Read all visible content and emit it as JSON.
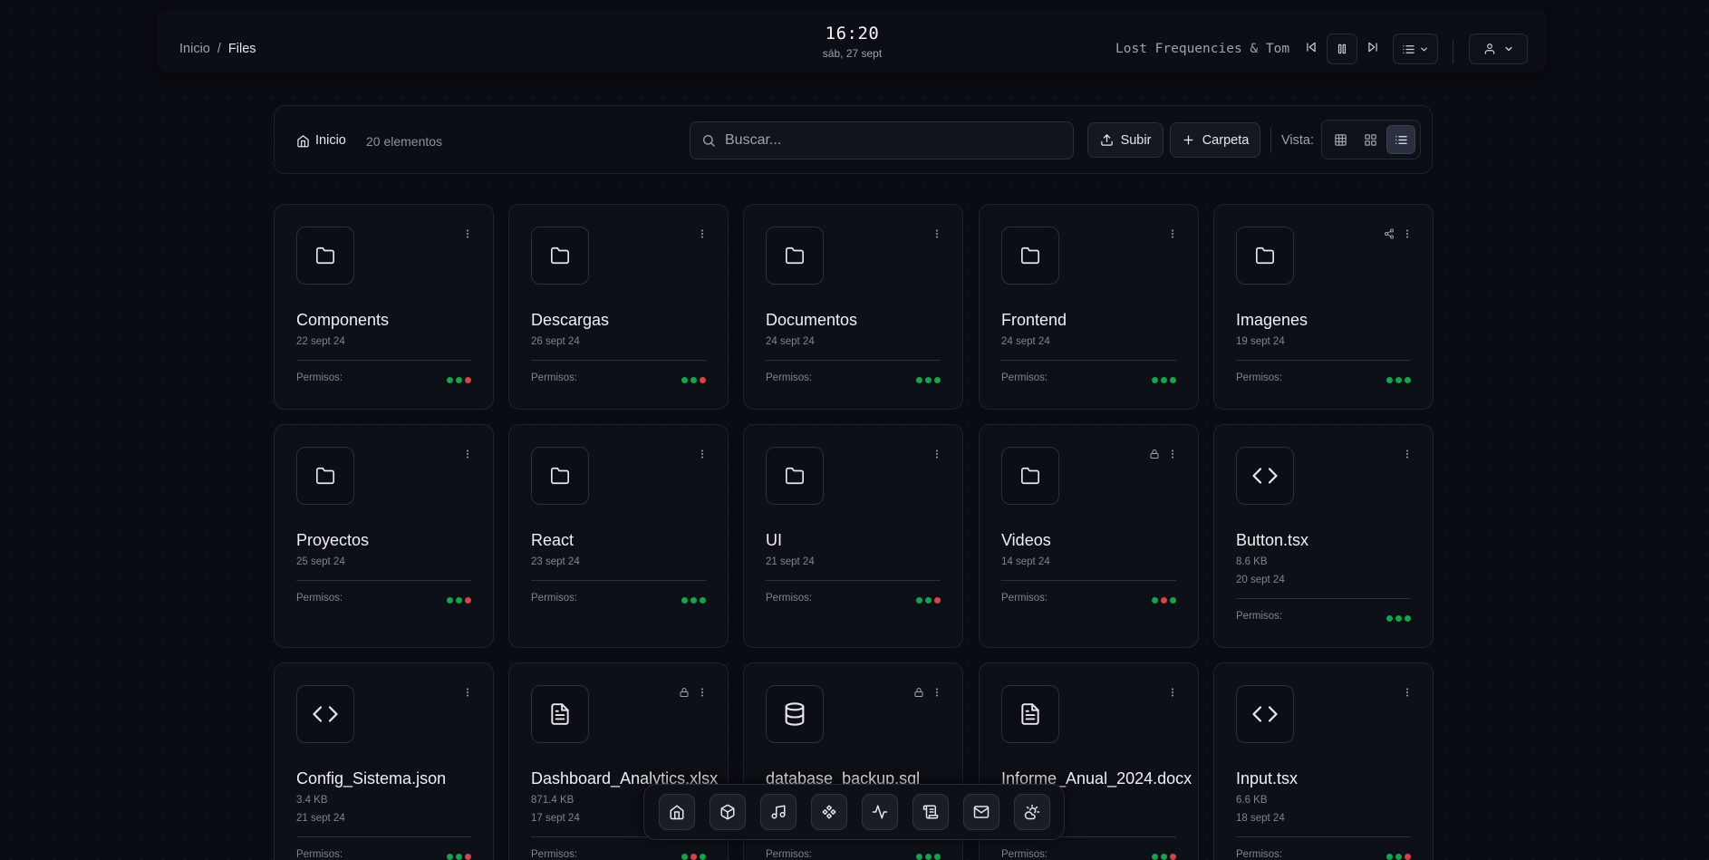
{
  "topbar": {
    "breadcrumb": {
      "root": "Inicio",
      "separator": "/",
      "current": "Files"
    },
    "clock": {
      "time": "16:20",
      "date": "sáb, 27 sept"
    },
    "now_playing": "Lost Frequencies & Tom",
    "player_icons": [
      "skip-back-icon",
      "pause-icon",
      "skip-forward-icon",
      "playlist-icon"
    ],
    "user_icon": "user-icon"
  },
  "toolbar": {
    "home_label": "Inicio",
    "item_count": "20 elementos",
    "search_placeholder": "Buscar...",
    "upload_label": "Subir",
    "folder_label": "Carpeta",
    "view_label": "Vista:",
    "view_modes": [
      "grid-large",
      "grid-small",
      "list"
    ],
    "active_view": "list"
  },
  "permissions_label": "Permisos:",
  "colors": {
    "granted": "#16a34a",
    "denied": "#d64545",
    "background": "#090c12"
  },
  "cards": [
    {
      "name": "Components",
      "type": "folder",
      "date": "22 sept 24",
      "perms": [
        "g",
        "g",
        "r"
      ]
    },
    {
      "name": "Descargas",
      "type": "folder",
      "date": "26 sept 24",
      "perms": [
        "g",
        "g",
        "r"
      ]
    },
    {
      "name": "Documentos",
      "type": "folder",
      "date": "24 sept 24",
      "perms": [
        "g",
        "g",
        "g"
      ]
    },
    {
      "name": "Frontend",
      "type": "folder",
      "date": "24 sept 24",
      "perms": [
        "g",
        "g",
        "g"
      ]
    },
    {
      "name": "Imagenes",
      "type": "folder",
      "date": "19 sept 24",
      "perms": [
        "g",
        "g",
        "g"
      ],
      "shared": true
    },
    {
      "name": "Proyectos",
      "type": "folder",
      "date": "25 sept 24",
      "perms": [
        "g",
        "g",
        "r"
      ]
    },
    {
      "name": "React",
      "type": "folder",
      "date": "23 sept 24",
      "perms": [
        "g",
        "g",
        "g"
      ]
    },
    {
      "name": "UI",
      "type": "folder",
      "date": "21 sept 24",
      "perms": [
        "g",
        "g",
        "r"
      ]
    },
    {
      "name": "Videos",
      "type": "folder",
      "date": "14 sept 24",
      "perms": [
        "g",
        "r",
        "g"
      ],
      "locked": true
    },
    {
      "name": "Button.tsx",
      "type": "code",
      "size": "8.6 KB",
      "date": "20 sept 24",
      "perms": [
        "g",
        "g",
        "g"
      ]
    },
    {
      "name": "Config_Sistema.json",
      "type": "code",
      "size": "3.4 KB",
      "date": "21 sept 24",
      "perms": [
        "g",
        "g",
        "r"
      ]
    },
    {
      "name": "Dashboard_Analytics.xlsx",
      "type": "document",
      "size": "871.4 KB",
      "date": "17 sept 24",
      "perms": [
        "g",
        "r",
        "g"
      ],
      "locked": true
    },
    {
      "name": "database_backup.sql",
      "type": "database",
      "size": "",
      "date": "",
      "perms": [
        "g",
        "g",
        "g"
      ],
      "locked": true
    },
    {
      "name": "Informe_Anual_2024.docx",
      "type": "document",
      "size": "",
      "date": "",
      "perms": [
        "g",
        "g",
        "r"
      ]
    },
    {
      "name": "Input.tsx",
      "type": "code",
      "size": "6.6 KB",
      "date": "18 sept 24",
      "perms": [
        "g",
        "g",
        "r"
      ]
    }
  ],
  "dock": [
    "home-icon",
    "package-icon",
    "music-icon",
    "gamepad-icon",
    "activity-icon",
    "scroll-icon",
    "mail-icon",
    "weather-icon"
  ]
}
